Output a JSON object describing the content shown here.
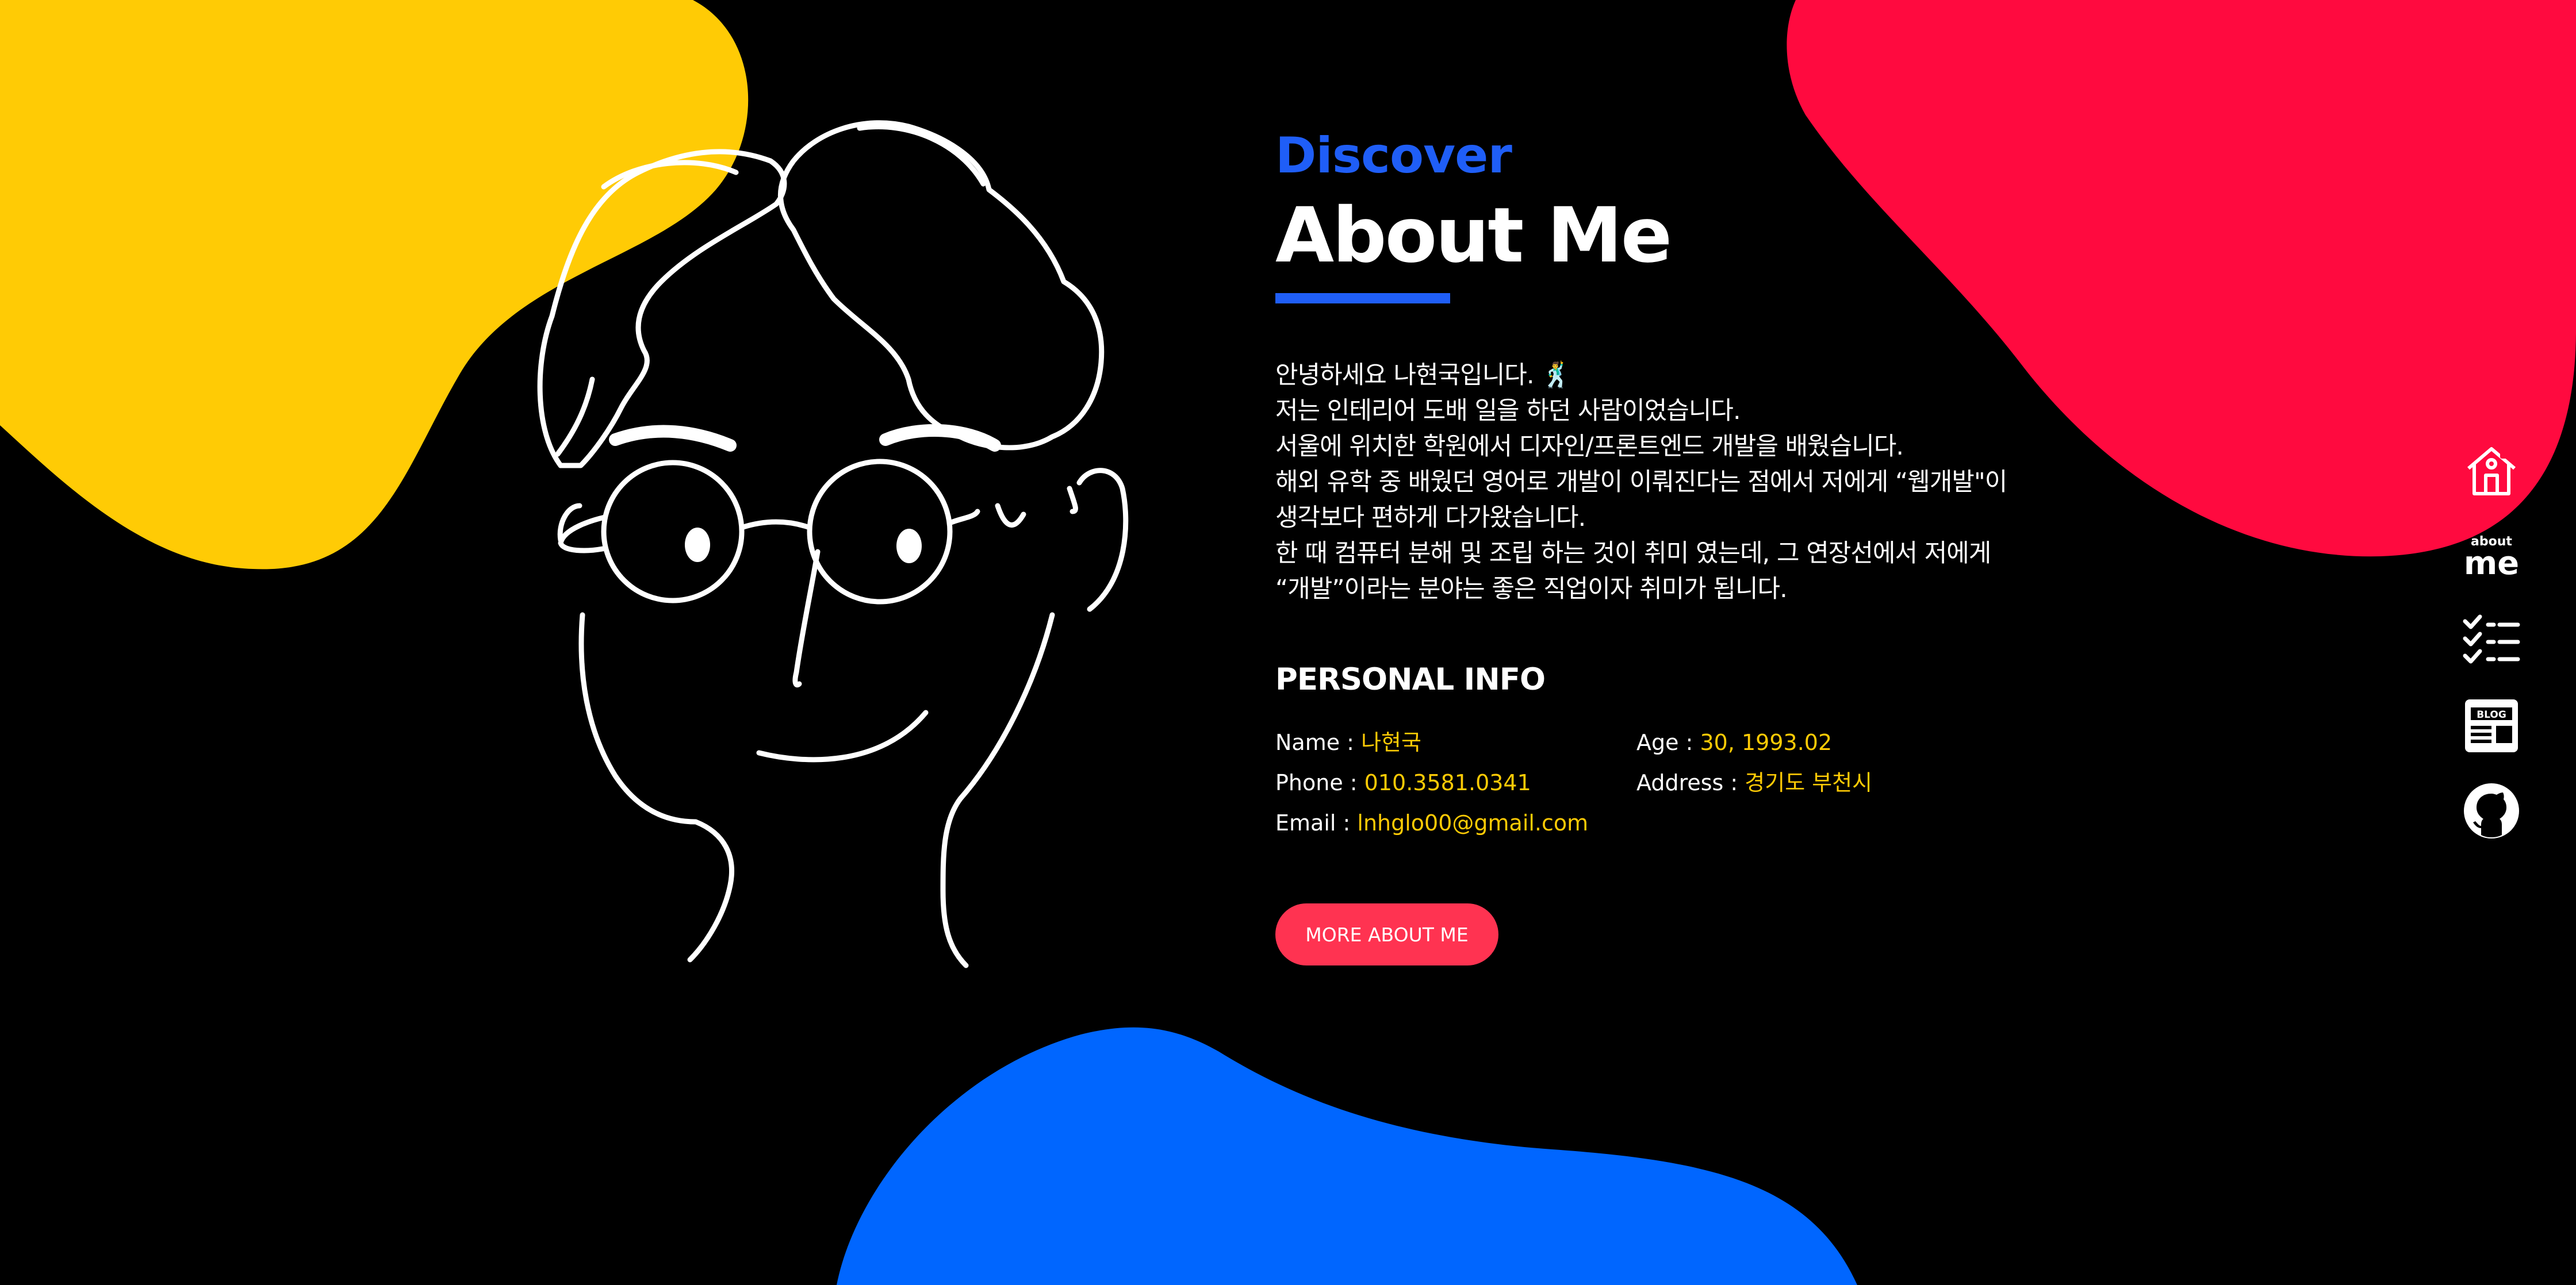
{
  "colors": {
    "background": "#000000",
    "yellow": "#ffcb05",
    "red": "#ff0a3f",
    "blue": "#0066ff",
    "accent_blue": "#1f5ef7",
    "button": "#ff3351"
  },
  "header": {
    "eyebrow": "Discover",
    "title": "About Me"
  },
  "intro": {
    "lines": [
      "안녕하세요 나현국입니다. 🕺",
      "저는 인테리어 도배 일을 하던 사람이었습니다.",
      "서울에 위치한 학원에서 디자인/프론트엔드 개발을 배웠습니다.",
      "해외 유학 중 배웠던 영어로 개발이 이뤄진다는 점에서 저에게 “웹개발\"이",
      "생각보다 편하게 다가왔습니다.",
      "한 때 컴퓨터 분해 및 조립 하는 것이 취미 였는데, 그 연장선에서 저에게",
      "“개발”이라는 분야는 좋은 직업이자 취미가 됩니다."
    ]
  },
  "personal_info": {
    "title": "PERSONAL INFO",
    "name": {
      "label": "Name : ",
      "value": "나현국"
    },
    "age": {
      "label": "Age : ",
      "value": "30, 1993.02"
    },
    "phone": {
      "label": "Phone : ",
      "value": "010.3581.0341"
    },
    "address": {
      "label": "Address : ",
      "value": "경기도 부천시"
    },
    "email": {
      "label": "Email : ",
      "value": "lnhglo00@gmail.com"
    }
  },
  "cta": {
    "label": "MORE ABOUT ME"
  },
  "sidenav": {
    "items": [
      {
        "icon": "home-icon"
      },
      {
        "icon": "about-me-icon",
        "small": "about",
        "big": "me"
      },
      {
        "icon": "checklist-icon"
      },
      {
        "icon": "blog-icon",
        "text": "BLOG"
      },
      {
        "icon": "github-icon"
      }
    ]
  }
}
